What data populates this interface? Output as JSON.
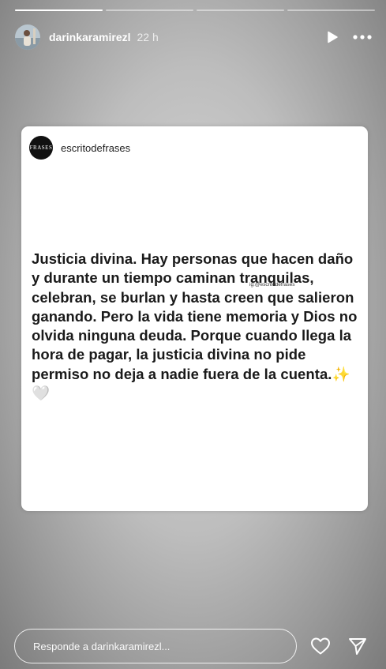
{
  "progress": [
    1.0,
    0.0,
    0.0,
    0.0
  ],
  "header": {
    "username": "darinkaramirezl",
    "time_ago": "22 h",
    "play_icon": "play-icon",
    "more_icon": "more-options-icon"
  },
  "post": {
    "brand_logo_text": "FRASES",
    "username": "escritodefrases",
    "watermark": "ig:@escritodefrases",
    "quote": "Justicia divina. Hay personas que hacen daño y durante un tiempo caminan tranquilas, celebran, se burlan y hasta creen que salieron ganando. Pero la vida tiene memoria y Dios no olvida ninguna deuda. Porque cuando llega la hora de pagar, la justicia divina no pide permiso no deja a nadie fuera de la cuenta.✨🤍"
  },
  "reply": {
    "placeholder": "Responde a darinkaramirezl...",
    "like_icon": "heart-icon",
    "share_icon": "send-icon"
  }
}
